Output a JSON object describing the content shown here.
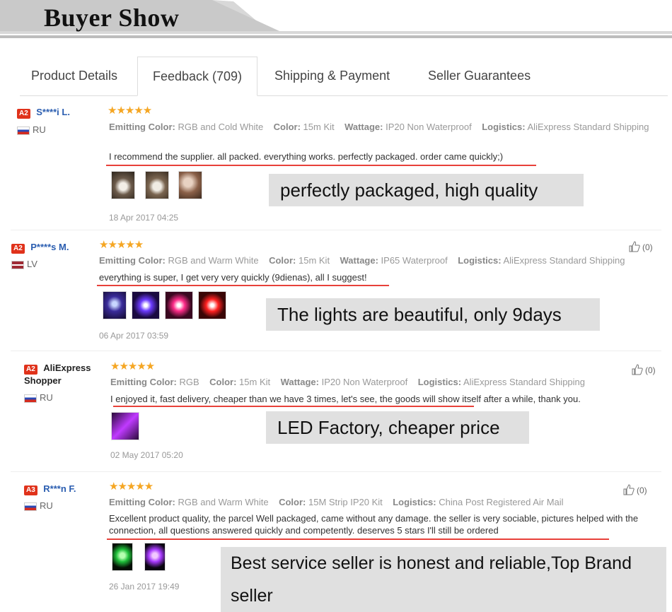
{
  "header": {
    "title": "Buyer Show"
  },
  "tabs": [
    {
      "label": "Product Details"
    },
    {
      "label": "Feedback (709)"
    },
    {
      "label": "Shipping & Payment"
    },
    {
      "label": "Seller Guarantees"
    }
  ],
  "colors": {
    "accent_red": "#e8413a",
    "star": "#f5a623",
    "user_blue": "#2a5db0",
    "callout_bg": "#e0e0e0"
  },
  "reviews": [
    {
      "level": "A2",
      "user": "S****i L.",
      "country": "RU",
      "stars": "★★★★★",
      "attrs": [
        {
          "k": "Emitting Color:",
          "v": "RGB and Cold White"
        },
        {
          "k": "Color:",
          "v": "15m Kit"
        },
        {
          "k": "Wattage:",
          "v": "IP20 Non Waterproof"
        },
        {
          "k": "Logistics:",
          "v": "AliExpress Standard Shipping"
        }
      ],
      "comment": "I recommend the supplier. all packed. everything works. perfectly packaged. order came quickly;)",
      "date": "18 Apr 2017 04:25",
      "callout": "perfectly packaged, high quality"
    },
    {
      "level": "A2",
      "user": "P****s M.",
      "country": "LV",
      "stars": "★★★★★",
      "likes": "(0)",
      "attrs": [
        {
          "k": "Emitting Color:",
          "v": "RGB and Warm White"
        },
        {
          "k": "Color:",
          "v": "15m Kit"
        },
        {
          "k": "Wattage:",
          "v": "IP65 Waterproof"
        },
        {
          "k": "Logistics:",
          "v": "AliExpress Standard Shipping"
        }
      ],
      "comment": "everything is super, I get very very quickly (9dienas), all I suggest!",
      "date": "06 Apr 2017 03:59",
      "callout": "The lights are beautiful, only 9days"
    },
    {
      "level": "A2",
      "user": "AliExpress Shopper",
      "country": "RU",
      "stars": "★★★★★",
      "likes": "(0)",
      "attrs": [
        {
          "k": "Emitting Color:",
          "v": "RGB"
        },
        {
          "k": "Color:",
          "v": "15m Kit"
        },
        {
          "k": "Wattage:",
          "v": "IP20 Non Waterproof"
        },
        {
          "k": "Logistics:",
          "v": "AliExpress Standard Shipping"
        }
      ],
      "comment": "I enjoyed it, fast delivery, cheaper than we have 3 times, let's see, the goods will show itself after a while, thank you.",
      "date": "02 May 2017 05:20",
      "callout": "LED Factory, cheaper price"
    },
    {
      "level": "A3",
      "user": "R***n F.",
      "country": "RU",
      "stars": "★★★★★",
      "likes": "(0)",
      "attrs": [
        {
          "k": "Emitting Color:",
          "v": "RGB and Warm White"
        },
        {
          "k": "Color:",
          "v": "15M Strip IP20 Kit"
        },
        {
          "k": "Logistics:",
          "v": "China Post Registered Air Mail"
        }
      ],
      "comment": "Excellent product quality, the parcel Well packaged, came without any damage. the seller is very sociable, pictures helped with the connection, all questions answered quickly and competently. deserves 5 stars I'll still be ordered",
      "date": "26 Jan 2017 19:49",
      "callout": "Best service seller is honest and reliable,Top Brand seller"
    }
  ],
  "icons": {
    "like": "thumbs-up-icon",
    "flag": "country-flag-icon",
    "star": "star-icon"
  }
}
